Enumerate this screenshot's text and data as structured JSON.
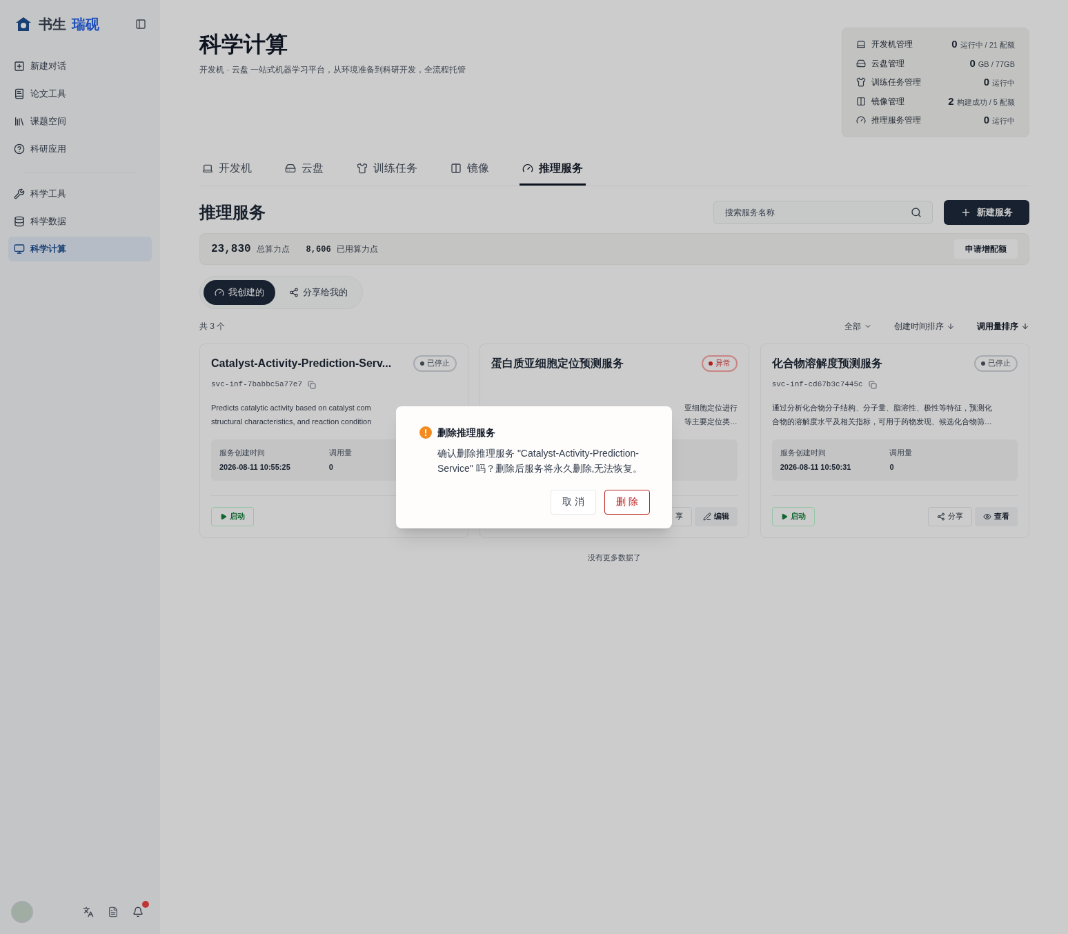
{
  "sidebar": {
    "brand": {
      "name": "书生",
      "accent": "瑞砚"
    },
    "items": [
      {
        "label": "新建对话",
        "selected": false
      },
      {
        "label": "论文工具",
        "selected": false
      },
      {
        "label": "课题空间",
        "selected": false
      },
      {
        "label": "科研应用",
        "selected": false
      },
      {
        "label": "科学工具",
        "selected": false
      },
      {
        "label": "科学数据",
        "selected": false
      },
      {
        "label": "科学计算",
        "selected": true
      }
    ],
    "notification_badge": true
  },
  "header": {
    "title": "科学计算",
    "subtitle": "开发机 · 云盘 一站式机器学习平台，从环境准备到科研开发，全流程托管",
    "stats": [
      {
        "label": "开发机管理",
        "value": "0",
        "unit": "运行中 / 21 配额"
      },
      {
        "label": "云盘管理",
        "value": "0",
        "unit": "GB / 77GB"
      },
      {
        "label": "训练任务管理",
        "value": "0",
        "unit": "运行中"
      },
      {
        "label": "镜像管理",
        "value": "2",
        "unit": "构建成功 / 5 配额"
      },
      {
        "label": "推理服务管理",
        "value": "0",
        "unit": "运行中"
      }
    ]
  },
  "tabs": [
    {
      "label": "开发机",
      "selected": false
    },
    {
      "label": "云盘",
      "selected": false
    },
    {
      "label": "训练任务",
      "selected": false
    },
    {
      "label": "镜像",
      "selected": false
    },
    {
      "label": "推理服务",
      "selected": true
    }
  ],
  "section": {
    "title": "推理服务",
    "search_placeholder": "搜索服务名称",
    "new_button": "新建服务"
  },
  "quota": {
    "total": "23,830",
    "total_label": "总算力点",
    "used": "8,606",
    "used_label": "已用算力点",
    "apply_button": "申请增配额"
  },
  "segments": [
    {
      "label": "我创建的",
      "selected": true
    },
    {
      "label": "分享给我的",
      "selected": false
    }
  ],
  "list_bar": {
    "count": "共 3 个",
    "filter": "全部",
    "sorts": [
      "创建时间排序",
      "调用量排序"
    ]
  },
  "cards": [
    {
      "name": "Catalyst-Activity-Prediction-Serv...",
      "status": "已停止",
      "kind": "stopped",
      "id": "svc-inf-7babbc5a77e7",
      "description": [
        "Predicts catalytic activity based on catalyst com",
        "structural characteristics, and reaction condition"
      ],
      "created_label": "服务创建时间",
      "created": "2026-08-11 10:55:25",
      "calls_label": "调用量",
      "calls": "0",
      "start_button": "启动"
    },
    {
      "name": "蛋白质亚细胞定位预测服务",
      "status": "异常",
      "kind": "error",
      "description": [
        "亚细胞定位进行",
        "等主要定位类…"
      ],
      "actions": [
        "享",
        "编辑"
      ]
    },
    {
      "name": "化合物溶解度预测服务",
      "status": "已停止",
      "kind": "stopped",
      "id": "svc-inf-cd67b3c7445c",
      "description": [
        "通过分析化合物分子结构、分子量、脂溶性、极性等特征，预测化",
        "合物的溶解度水平及相关指标，可用于药物发现、候选化合物筛…"
      ],
      "created_label": "服务创建时间",
      "created": "2026-08-11 10:50:31",
      "calls_label": "调用量",
      "calls": "0",
      "start_button": "启动",
      "actions": [
        "分享",
        "查看"
      ]
    }
  ],
  "end_text": "没有更多数据了",
  "dialog": {
    "title": "删除推理服务",
    "message": "确认删除推理服务 \"Catalyst-Activity-Prediction-Service\" 吗？删除后服务将永久删除,无法恢复。",
    "cancel": "取 消",
    "confirm": "删 除"
  }
}
